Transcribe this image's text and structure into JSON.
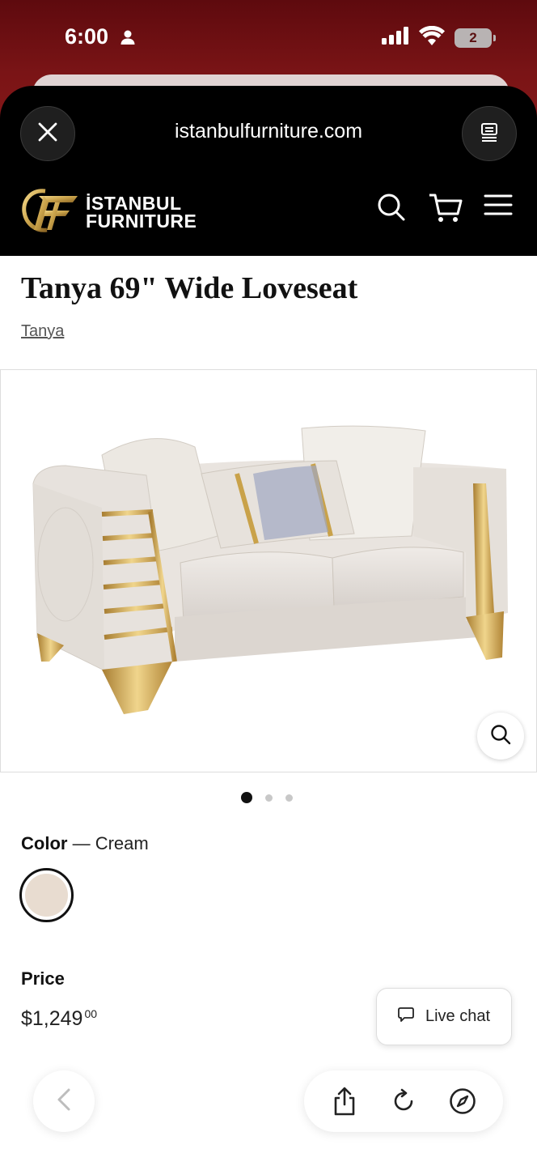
{
  "status_bar": {
    "time": "6:00",
    "battery_level": "2",
    "icons": [
      "person-icon",
      "signal-icon",
      "wifi-icon",
      "battery-icon"
    ]
  },
  "browser": {
    "url": "istanbulfurniture.com",
    "close_icon": "close-icon",
    "reader_icon": "reader-mode-icon"
  },
  "site_header": {
    "logo_line1": "İSTANBUL",
    "logo_line2": "FURNITURE",
    "icons": [
      "search-icon",
      "cart-icon",
      "menu-icon"
    ]
  },
  "product": {
    "title": "Tanya 69\" Wide Loveseat",
    "collection": "Tanya",
    "image_count": 3,
    "active_image": 1,
    "color_label": "Color",
    "color_separator": " — ",
    "color_value": "Cream",
    "swatch_color": "#e8dcd0",
    "price_label": "Price",
    "price_main": "$1,249",
    "price_cents": "00"
  },
  "live_chat": {
    "label": "Live chat"
  },
  "toolbar": {
    "icons": [
      "back-icon",
      "share-icon",
      "reload-icon",
      "compass-icon"
    ]
  },
  "colors": {
    "status_bg": "#7a1416",
    "header_bg": "#000000",
    "gold": "#c9a24a"
  }
}
